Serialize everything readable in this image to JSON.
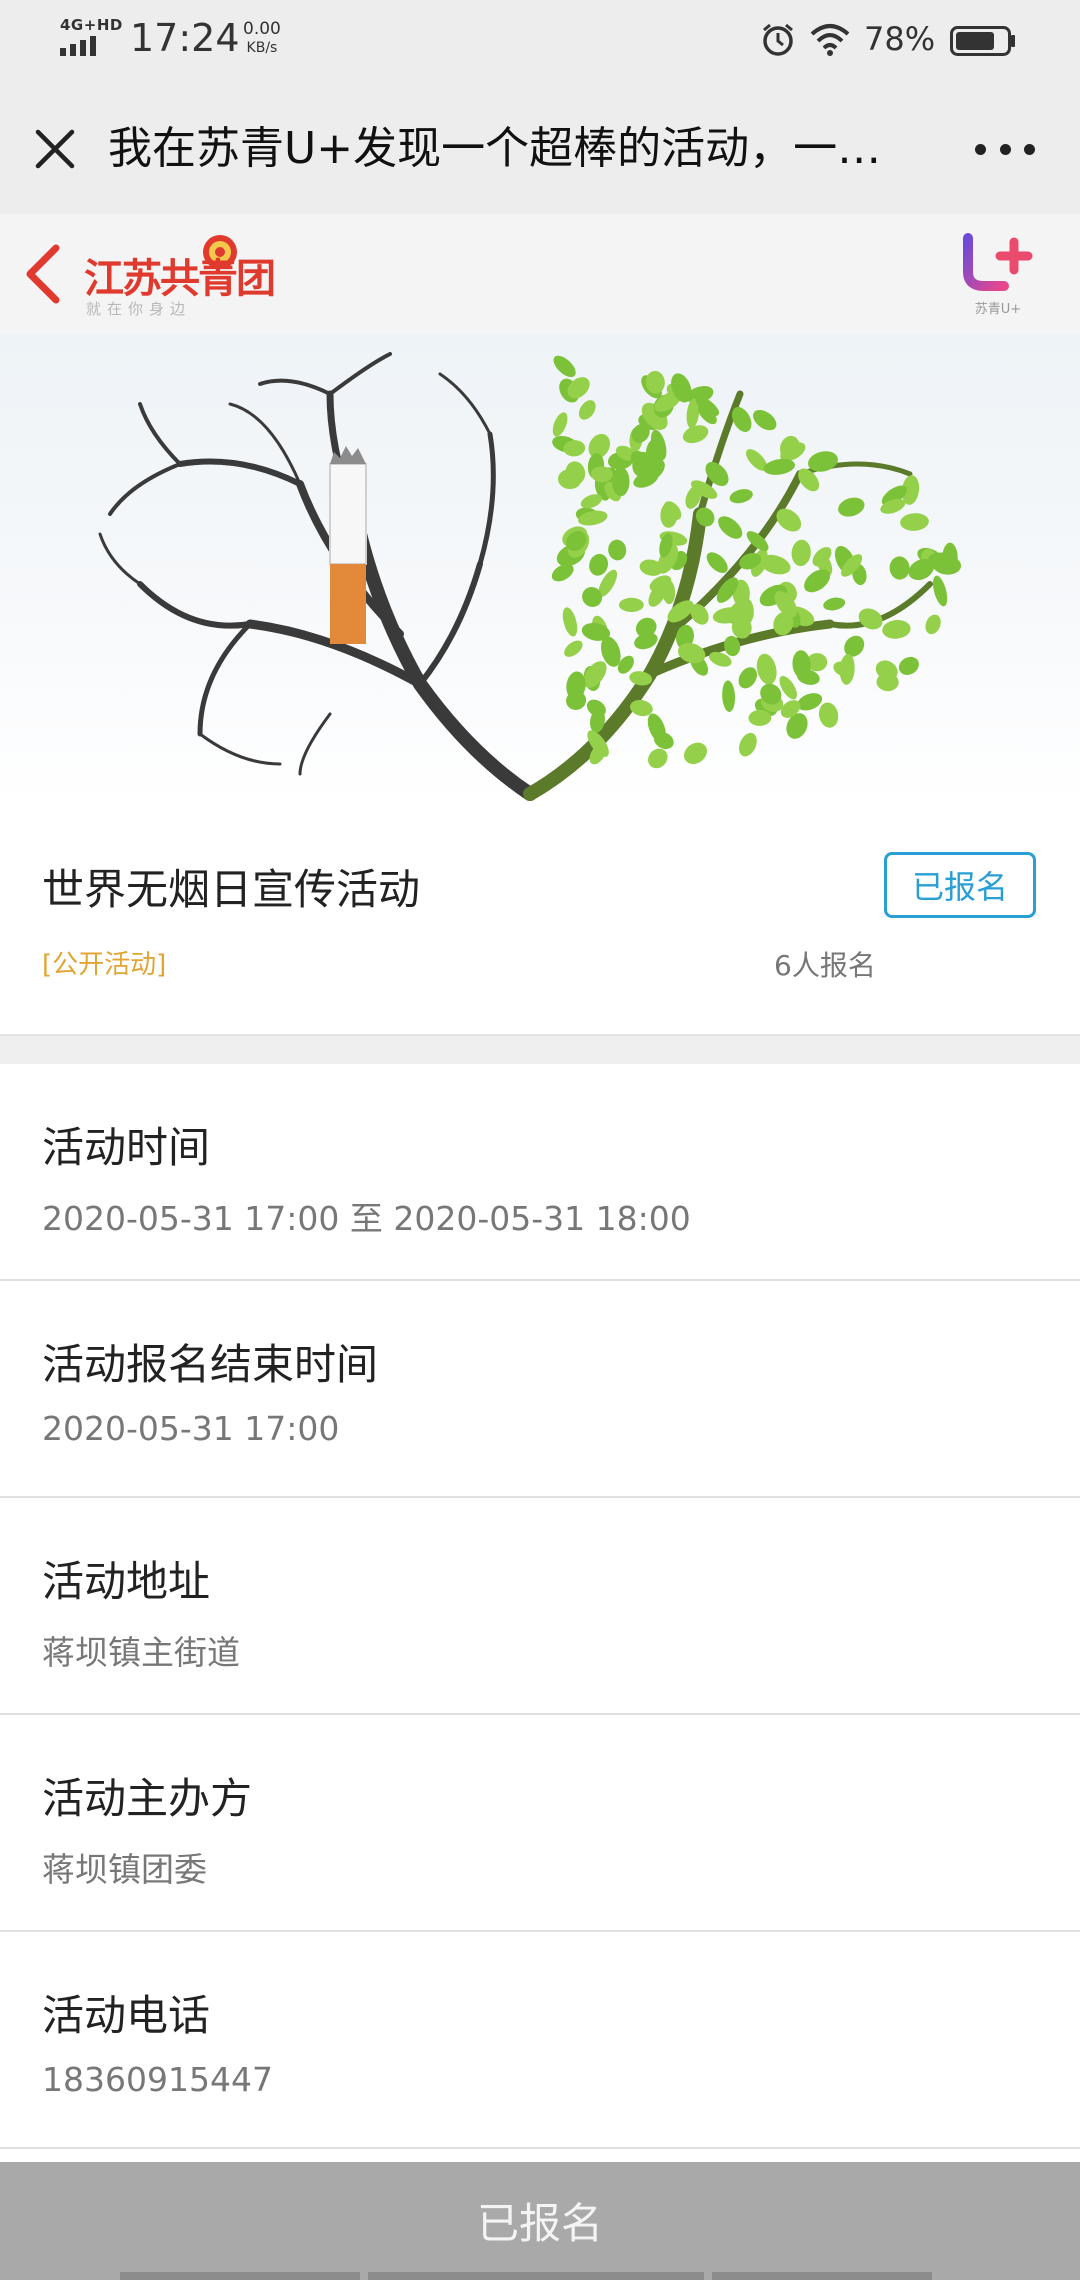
{
  "status_bar": {
    "network": "4G+HD",
    "time": "17:24",
    "speed_value": "0.00",
    "speed_unit": "KB/s",
    "battery_percent": "78%",
    "battery_level": 0.78,
    "icons": [
      "signal-icon",
      "alarm-icon",
      "wifi-icon",
      "battery-icon"
    ]
  },
  "titlebar": {
    "title": "我在苏青U+发现一个超棒的活动，一…",
    "close_icon": "close-icon",
    "more_icon": "more-icon"
  },
  "app_header": {
    "logo_text": "江苏共青团",
    "logo_slogan": "就在你身边",
    "brand_text": "苏青U+",
    "back_icon": "chevron-left-icon"
  },
  "activity": {
    "title": "世界无烟日宣传活动",
    "tag": "[公开活动]",
    "signup_count": "6人报名",
    "status_button": "已报名"
  },
  "details": [
    {
      "label": "活动时间",
      "value": "2020-05-31 17:00 至 2020-05-31 18:00"
    },
    {
      "label": "活动报名结束时间",
      "value": "2020-05-31 17:00"
    },
    {
      "label": "活动地址",
      "value": "蒋坝镇主街道"
    },
    {
      "label": "活动主办方",
      "value": "蒋坝镇团委"
    },
    {
      "label": "活动电话",
      "value": "18360915447"
    }
  ],
  "bottom_bar": {
    "label": "已报名"
  },
  "colors": {
    "accent_blue": "#2a9fd6",
    "tag_orange": "#e2a533",
    "brand_red": "#e03a2f",
    "bottom_bar_gray": "#a9a9a9"
  }
}
